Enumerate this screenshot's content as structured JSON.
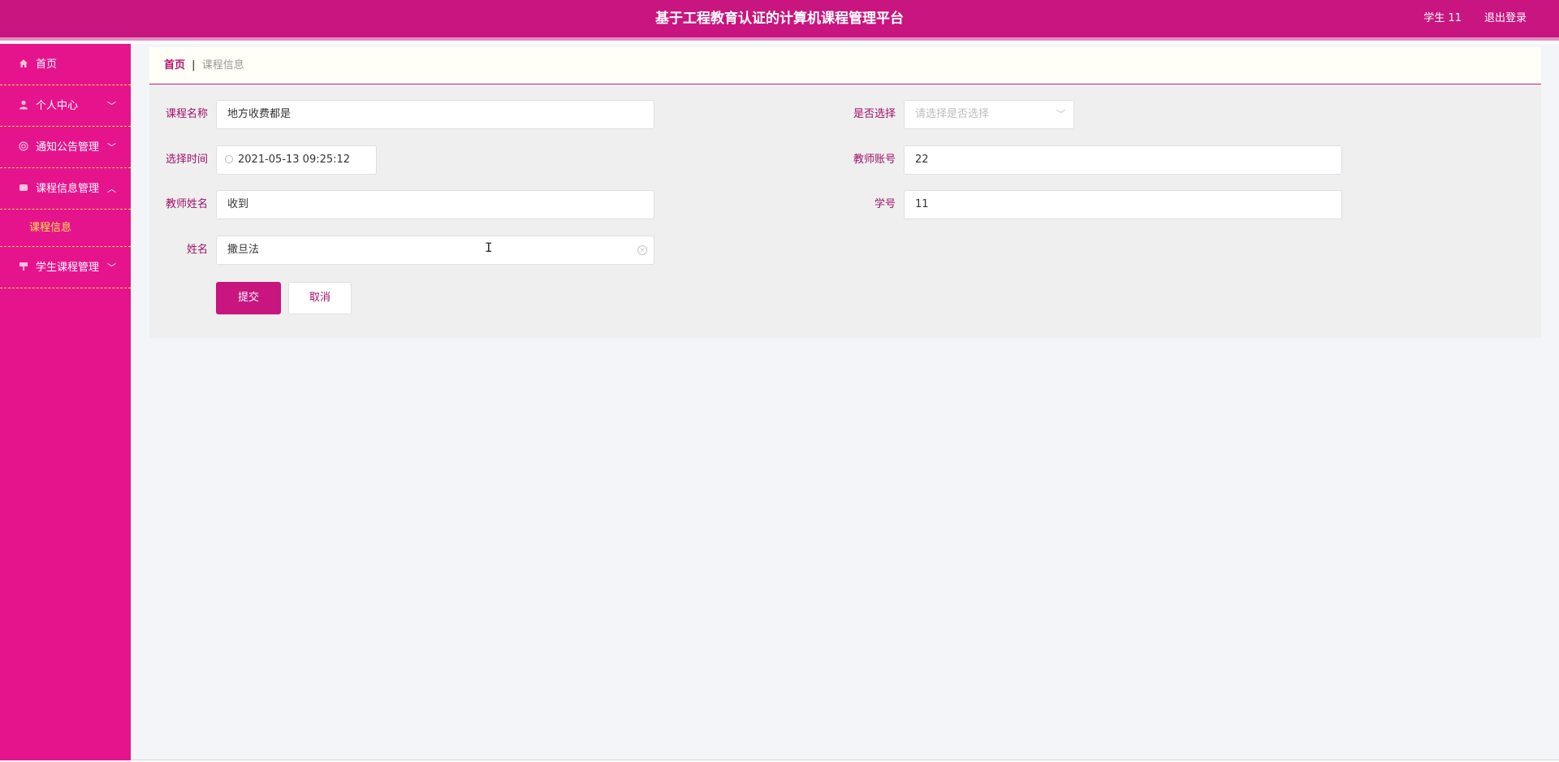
{
  "header": {
    "title": "基于工程教育认证的计算机课程管理平台",
    "user": "学生 11",
    "logout": "退出登录"
  },
  "sidebar": {
    "items": [
      {
        "label": "首页",
        "icon": "home-icon"
      },
      {
        "label": "个人中心",
        "icon": "user-icon"
      },
      {
        "label": "通知公告管理",
        "icon": "notice-icon"
      },
      {
        "label": "课程信息管理",
        "icon": "course-icon"
      },
      {
        "label": "学生课程管理",
        "icon": "student-course-icon"
      }
    ],
    "submenu": {
      "label": "课程信息"
    }
  },
  "breadcrumb": {
    "home": "首页",
    "separator": "|",
    "current": "课程信息"
  },
  "form": {
    "course_name": {
      "label": "课程名称",
      "value": "地方收费都是"
    },
    "is_selected": {
      "label": "是否选择",
      "placeholder": "请选择是否选择"
    },
    "select_time": {
      "label": "选择时间",
      "value": "2021-05-13 09:25:12"
    },
    "teacher_account": {
      "label": "教师账号",
      "value": "22"
    },
    "teacher_name": {
      "label": "教师姓名",
      "value": "收到"
    },
    "student_id": {
      "label": "学号",
      "value": "11"
    },
    "name": {
      "label": "姓名",
      "value": "撒旦法"
    }
  },
  "buttons": {
    "submit": "提交",
    "cancel": "取消"
  },
  "colors": {
    "header_bg": "#c8157f",
    "sidebar_bg": "#e6148c",
    "submenu_active": "#f9e24b",
    "label": "#a1106a"
  }
}
